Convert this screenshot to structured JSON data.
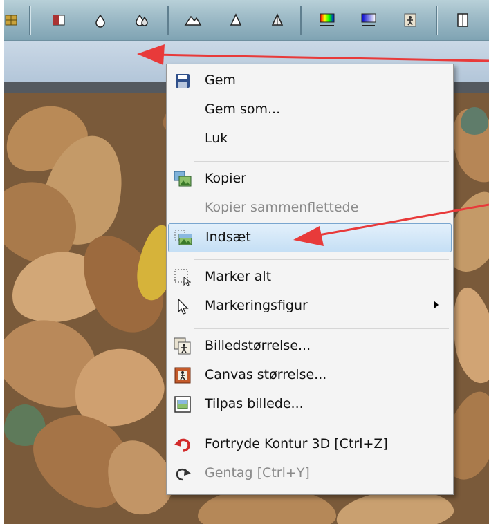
{
  "toolbar": {
    "icons": [
      "grid-icon",
      "split-view-icon",
      "drop-small-icon",
      "drops-icon",
      "mountain-icon",
      "cone-icon",
      "cone-outline-icon",
      "color-gradient-icon",
      "blue-gradient-icon",
      "figure-icon",
      "page-icon"
    ]
  },
  "menu": {
    "items": [
      {
        "label": "Gem",
        "icon": "floppy-disk-icon"
      },
      {
        "label": "Gem som..."
      },
      {
        "label": "Luk"
      },
      {
        "label": "Kopier",
        "icon": "copy-image-icon"
      },
      {
        "label": "Kopier sammenflettede",
        "disabled": true
      },
      {
        "label": "Indsæt",
        "icon": "paste-image-icon",
        "highlighted": true
      },
      {
        "label": "Marker alt",
        "icon": "select-all-icon"
      },
      {
        "label": "Markeringsfigur",
        "icon": "pointer-icon",
        "has_submenu": true
      },
      {
        "label": "Billedstørrelse...",
        "icon": "image-size-icon"
      },
      {
        "label": "Canvas størrelse...",
        "icon": "canvas-size-icon"
      },
      {
        "label": "Tilpas billede...",
        "icon": "fit-image-icon"
      },
      {
        "label": "Fortryde Kontur 3D [Ctrl+Z]",
        "icon": "undo-icon"
      },
      {
        "label": "Gentag [Ctrl+Y]",
        "icon": "redo-icon",
        "disabled": true
      }
    ]
  },
  "colors": {
    "annotation_arrow": "#e83a3a",
    "highlight": "#c5dff5",
    "undo_icon": "#d22b2b"
  }
}
